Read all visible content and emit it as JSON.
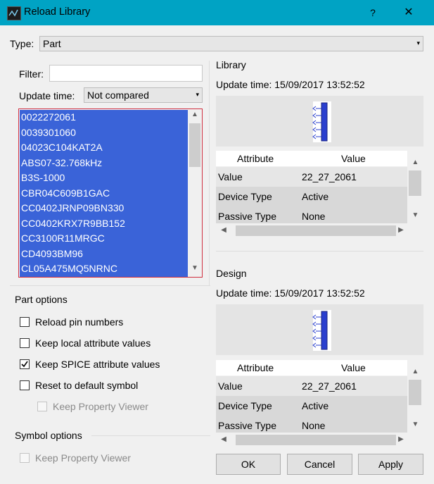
{
  "window": {
    "title": "Reload Library",
    "help_label": "?",
    "close_label": "✕"
  },
  "type": {
    "label": "Type:",
    "value": "Part"
  },
  "filter": {
    "label": "Filter:",
    "value": ""
  },
  "update_time": {
    "label": "Update time:",
    "value": "Not compared"
  },
  "parts": [
    "0022272061",
    "0039301060",
    "04023C104KAT2A",
    "ABS07-32.768kHz",
    "B3S-1000",
    "CBR04C609B1GAC",
    "CC0402JRNP09BN330",
    "CC0402KRX7R9BB152",
    "CC3100R11MRGC",
    "CD4093BM96",
    "CL05A475MQ5NRNC"
  ],
  "part_options": {
    "title": "Part options",
    "reload_pin_numbers": {
      "label": "Reload pin numbers",
      "checked": false
    },
    "keep_local_attr": {
      "label": "Keep local attribute values",
      "checked": false
    },
    "keep_spice_attr": {
      "label": "Keep SPICE attribute values",
      "checked": true
    },
    "reset_default_symbol": {
      "label": "Reset to default symbol",
      "checked": false
    },
    "keep_property_viewer": {
      "label": "Keep Property Viewer",
      "checked": false,
      "disabled": true
    }
  },
  "symbol_options": {
    "title": "Symbol options",
    "keep_property_viewer": {
      "label": "Keep Property Viewer",
      "checked": false,
      "disabled": true
    }
  },
  "library": {
    "title": "Library",
    "update_time": "Update time: 15/09/2017 13:52:52",
    "headers": {
      "attribute": "Attribute",
      "value": "Value"
    },
    "rows": [
      {
        "attr": "Value",
        "val": "22_27_2061"
      },
      {
        "attr": "Device Type",
        "val": "Active"
      },
      {
        "attr": "Passive Type",
        "val": "None"
      }
    ]
  },
  "design": {
    "title": "Design",
    "update_time": "Update time: 15/09/2017 13:52:52",
    "headers": {
      "attribute": "Attribute",
      "value": "Value"
    },
    "rows": [
      {
        "attr": "Value",
        "val": "22_27_2061"
      },
      {
        "attr": "Device Type",
        "val": "Active"
      },
      {
        "attr": "Passive Type",
        "val": "None"
      }
    ]
  },
  "buttons": {
    "ok": "OK",
    "cancel": "Cancel",
    "apply": "Apply"
  },
  "arrows": {
    "up": "▲",
    "down": "▼",
    "left": "◀",
    "right": "▶",
    "combo": "▾"
  }
}
